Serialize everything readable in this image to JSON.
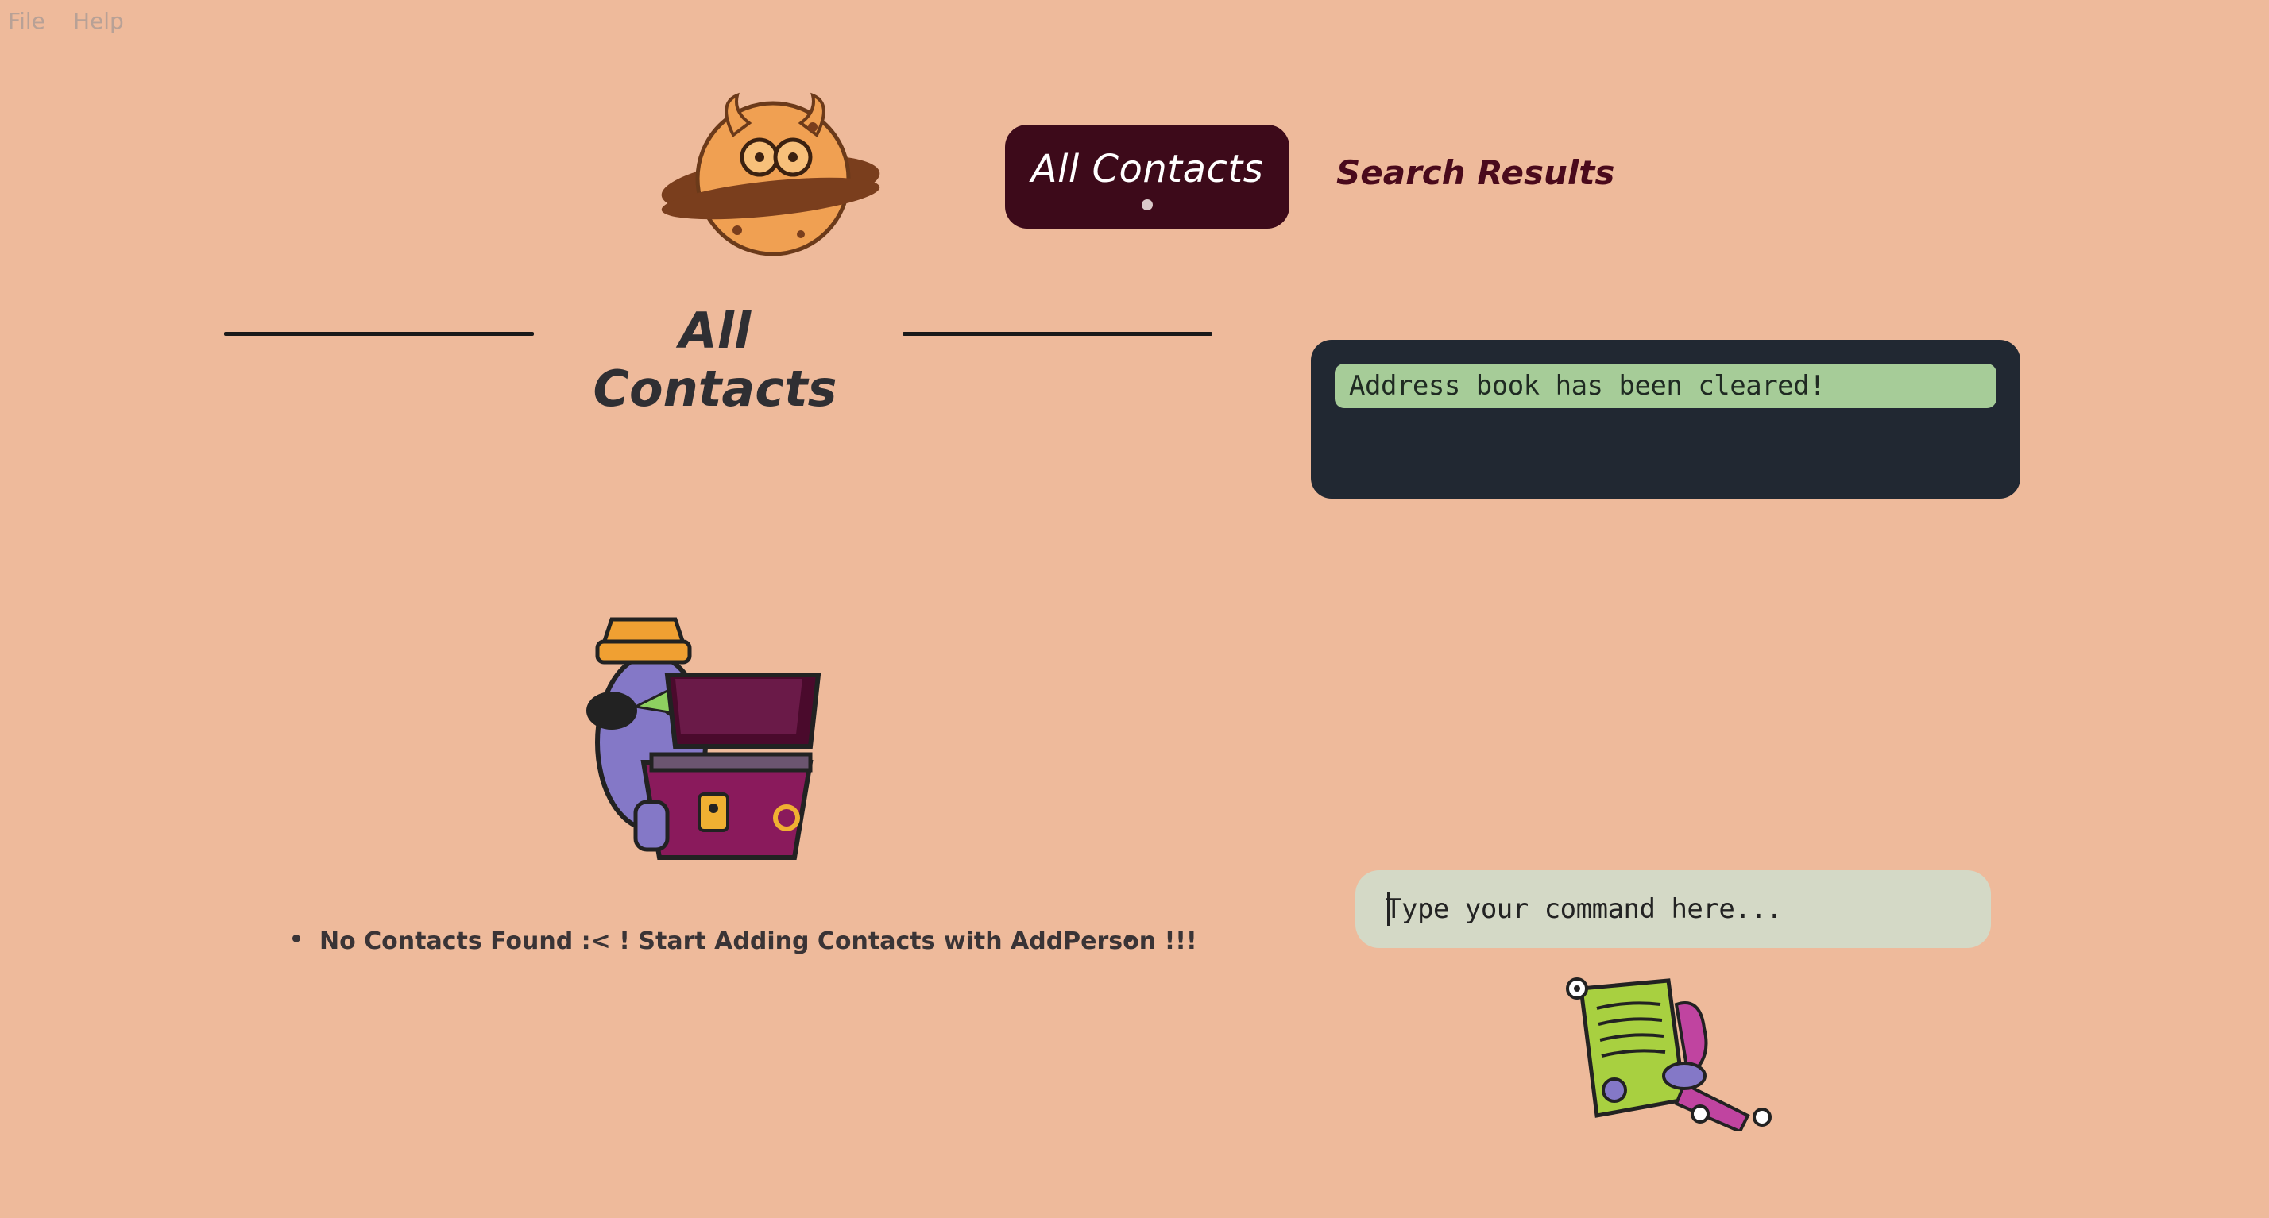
{
  "menu": {
    "file": "File",
    "help": "Help"
  },
  "tabs": {
    "active": "All Contacts",
    "inactive": "Search Results"
  },
  "section": {
    "title": "All Contacts"
  },
  "contacts": {
    "empty_message": "No Contacts Found :< ! Start Adding Contacts with AddPerson !!!"
  },
  "result": {
    "message": "Address book has been cleared!"
  },
  "command": {
    "placeholder": "Type your command here..."
  },
  "icons": {
    "logo": "planet-cookie-monster-icon",
    "empty_illustration": "pirate-treasure-chest-icon",
    "command_illustration": "document-writing-icon",
    "bullet": "bullet-dot"
  },
  "colors": {
    "background": "#eeba9b",
    "active_tab": "#3d0a1a",
    "inactive_tab_text": "#4a0a1c",
    "result_box": "#212832",
    "result_message": "#a6cc98",
    "command_box": "#d4d9c6"
  }
}
